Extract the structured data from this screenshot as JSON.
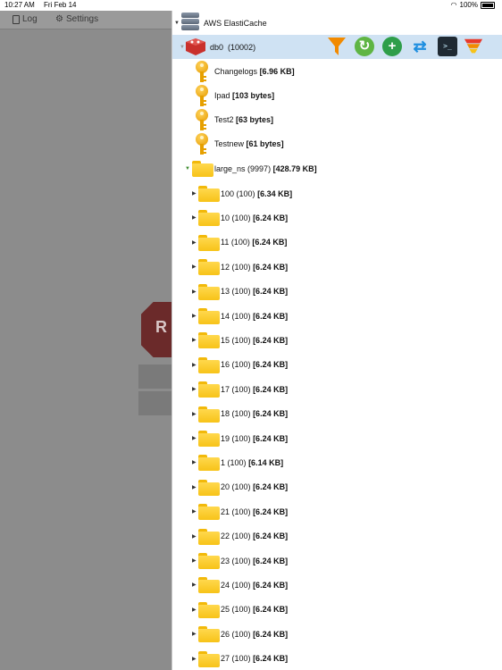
{
  "status_bar": {
    "time": "10:27 AM",
    "date": "Fri Feb 14",
    "battery": "100%"
  },
  "background_app": {
    "log_label": "Log",
    "settings_label": "Settings"
  },
  "tree": {
    "connection": {
      "label": "AWS ElastiCache"
    },
    "database": {
      "label": "db0",
      "count": "(10002)"
    },
    "keys": [
      {
        "name": "Changelogs",
        "size": "[6.96 KB]"
      },
      {
        "name": "Ipad",
        "size": "[103 bytes]"
      },
      {
        "name": "Test2",
        "size": "[63 bytes]"
      },
      {
        "name": "Testnew",
        "size": "[61 bytes]"
      }
    ],
    "namespace": {
      "name": "large_ns",
      "count": "(9997)",
      "size": "[428.79 KB]"
    },
    "folders": [
      {
        "name": "100",
        "count": "(100)",
        "size": "[6.34 KB]"
      },
      {
        "name": "10",
        "count": "(100)",
        "size": "[6.24 KB]"
      },
      {
        "name": "11",
        "count": "(100)",
        "size": "[6.24 KB]"
      },
      {
        "name": "12",
        "count": "(100)",
        "size": "[6.24 KB]"
      },
      {
        "name": "13",
        "count": "(100)",
        "size": "[6.24 KB]"
      },
      {
        "name": "14",
        "count": "(100)",
        "size": "[6.24 KB]"
      },
      {
        "name": "15",
        "count": "(100)",
        "size": "[6.24 KB]"
      },
      {
        "name": "16",
        "count": "(100)",
        "size": "[6.24 KB]"
      },
      {
        "name": "17",
        "count": "(100)",
        "size": "[6.24 KB]"
      },
      {
        "name": "18",
        "count": "(100)",
        "size": "[6.24 KB]"
      },
      {
        "name": "19",
        "count": "(100)",
        "size": "[6.24 KB]"
      },
      {
        "name": "1",
        "count": "(100)",
        "size": "[6.14 KB]"
      },
      {
        "name": "20",
        "count": "(100)",
        "size": "[6.24 KB]"
      },
      {
        "name": "21",
        "count": "(100)",
        "size": "[6.24 KB]"
      },
      {
        "name": "22",
        "count": "(100)",
        "size": "[6.24 KB]"
      },
      {
        "name": "23",
        "count": "(100)",
        "size": "[6.24 KB]"
      },
      {
        "name": "24",
        "count": "(100)",
        "size": "[6.24 KB]"
      },
      {
        "name": "25",
        "count": "(100)",
        "size": "[6.24 KB]"
      },
      {
        "name": "26",
        "count": "(100)",
        "size": "[6.24 KB]"
      },
      {
        "name": "27",
        "count": "(100)",
        "size": "[6.24 KB]"
      }
    ]
  },
  "toolbar_icons": [
    "filter-icon",
    "refresh-icon",
    "add-icon",
    "swap-icon",
    "terminal-icon",
    "clear-filter-icon"
  ],
  "colors": {
    "selected_row": "#cfe2f3",
    "folder": "#f7c318",
    "key": "#e59b00",
    "redis": "#c9302c",
    "filter": "#f28a00"
  }
}
